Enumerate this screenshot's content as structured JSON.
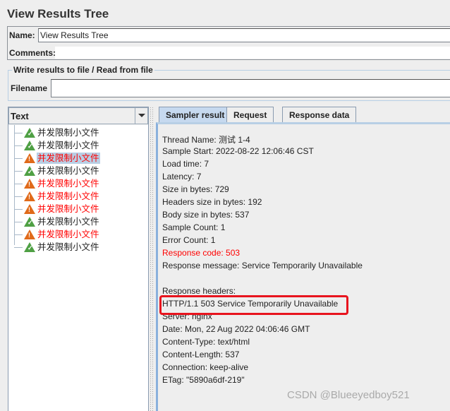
{
  "title": "View Results Tree",
  "name": {
    "label": "Name:",
    "value": "View Results Tree"
  },
  "comments": {
    "label": "Comments:",
    "value": ""
  },
  "file_section": {
    "legend": "Write results to file / Read from file",
    "filename_label": "Filename",
    "filename_value": ""
  },
  "renderer": {
    "selected": "Text"
  },
  "tree": [
    {
      "label": "并发限制小文件",
      "status": "success"
    },
    {
      "label": "并发限制小文件",
      "status": "success"
    },
    {
      "label": "并发限制小文件",
      "status": "error",
      "selected": true
    },
    {
      "label": "并发限制小文件",
      "status": "success"
    },
    {
      "label": "并发限制小文件",
      "status": "error"
    },
    {
      "label": "并发限制小文件",
      "status": "error"
    },
    {
      "label": "并发限制小文件",
      "status": "error"
    },
    {
      "label": "并发限制小文件",
      "status": "success"
    },
    {
      "label": "并发限制小文件",
      "status": "error"
    },
    {
      "label": "并发限制小文件",
      "status": "success"
    }
  ],
  "tabs": [
    {
      "label": "Sampler result",
      "active": true
    },
    {
      "label": "Request"
    },
    {
      "label": "Response data"
    }
  ],
  "result_lines": [
    {
      "text": "Thread Name: 测试 1-4"
    },
    {
      "text": "Sample Start: 2022-08-22 12:06:46 CST"
    },
    {
      "text": "Load time: 7"
    },
    {
      "text": "Latency: 7"
    },
    {
      "text": "Size in bytes: 729"
    },
    {
      "text": "Headers size in bytes: 192"
    },
    {
      "text": "Body size in bytes: 537"
    },
    {
      "text": "Sample Count: 1"
    },
    {
      "text": "Error Count: 1"
    },
    {
      "text": "Response code: 503",
      "color": "#ff0000"
    },
    {
      "text": "Response message: Service Temporarily Unavailable"
    },
    {
      "text": ""
    },
    {
      "text": "Response headers:"
    },
    {
      "text": "HTTP/1.1 503 Service Temporarily Unavailable",
      "highlighted": true
    },
    {
      "text": "Server: nginx"
    },
    {
      "text": "Date: Mon, 22 Aug 2022 04:06:46 GMT"
    },
    {
      "text": "Content-Type: text/html"
    },
    {
      "text": "Content-Length: 537"
    },
    {
      "text": "Connection: keep-alive"
    },
    {
      "text": "ETag: \"5890a6df-219\""
    }
  ],
  "colors": {
    "success": "#4fa044",
    "error": "#e06a1a",
    "error_text": "#ff0000",
    "highlight_box": "#e8141e"
  },
  "watermark": "CSDN @Blueeyedboy521"
}
